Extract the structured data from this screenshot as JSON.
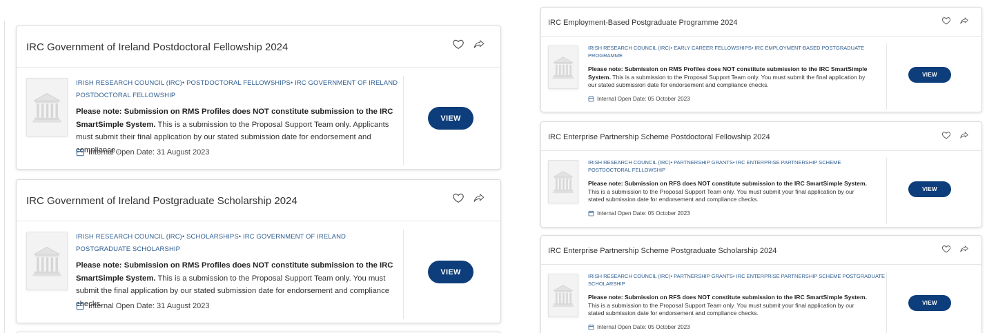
{
  "colors": {
    "accent": "#0d3d7a",
    "link": "#2e5d91",
    "border": "#dcdcdc",
    "text": "#333333",
    "background": "#ffffff"
  },
  "separator": "•",
  "icons": {
    "favourite": "heart-icon",
    "share": "share-icon",
    "thumbnail": "building-icon",
    "date": "calendar-icon"
  },
  "left_column": [
    {
      "title": "IRC Government of Ireland Postdoctoral Fellowship 2024",
      "crumbs": [
        "IRISH RESEARCH COUNCIL (IRC)",
        "POSTDOCTORAL FELLOWSHIPS",
        "IRC GOVERNMENT OF IRELAND POSTDOCTORAL FELLOWSHIP"
      ],
      "desc_bold": "Please note: Submission on RMS Profiles does NOT constitute submission to the IRC SmartSimple System.",
      "desc_text": "This is a submission to the Proposal Support Team only. Applicants must submit their final application by our stated submission date for endorsement and compliance...",
      "date": "Internal Open Date: 31 August 2023",
      "view_label": "VIEW"
    },
    {
      "title": "IRC Government of Ireland Postgraduate Scholarship 2024",
      "crumbs": [
        "IRISH RESEARCH COUNCIL (IRC)",
        "SCHOLARSHIPS",
        "IRC GOVERNMENT OF IRELAND POSTGRADUATE SCHOLARSHIP"
      ],
      "desc_bold": "Please note: Submission on RMS Profiles does NOT constitute submission to the IRC SmartSimple System.",
      "desc_text": "This is a submission to the Proposal Support Team only. You must submit the final application by our stated submission date for endorsement and compliance checks.",
      "date": "Internal Open Date: 31 August 2023",
      "view_label": "VIEW"
    }
  ],
  "right_column": [
    {
      "title": "IRC Employment-Based Postgraduate Programme 2024",
      "crumbs": [
        "IRISH RESEARCH COUNCIL (IRC)",
        "EARLY CAREER FELLOWSHIPS",
        "IRC EMPLOYMENT-BASED POSTGRADUATE PROGRAMME"
      ],
      "desc_bold": "Please note: Submission on RMS Profiles does NOT constitute submission to the IRC SmartSimple System.",
      "desc_text": "This is a submission to the Proposal Support Team only. You must submit the final application by our stated submission date for endorsement and compliance checks.",
      "date": "Internal Open Date: 05 October 2023",
      "view_label": "VIEW"
    },
    {
      "title": "IRC Enterprise Partnership Scheme Postdoctoral Fellowship 2024",
      "crumbs": [
        "IRISH RESEARCH COUNCIL (IRC)",
        "PARTNERSHIP GRANTS",
        "IRC ENTERPRISE PARTNERSHIP SCHEME POSTDOCTORAL FELLOWSHIP"
      ],
      "desc_bold": "Please note: Submission on RFS does NOT constitute submission to the IRC SmartSimple System.",
      "desc_text": "This is a submission to the Proposal Support Team only. You must submit your final application by our stated submission date for endorsement and compliance checks.",
      "date": "Internal Open Date: 05 October 2023",
      "view_label": "VIEW"
    },
    {
      "title": "IRC Enterprise Partnership Scheme Postgraduate Scholarship 2024",
      "crumbs": [
        "IRISH RESEARCH COUNCIL (IRC)",
        "PARTNERSHIP GRANTS",
        "IRC ENTERPRISE PARTNERSHIP SCHEME POSTGRADUATE SCHOLARSHIP"
      ],
      "desc_bold": "Please note: Submission on RFS does NOT constitute submission to the IRC SmartSimple System.",
      "desc_text": "This is a submission to the Proposal Support Team only. You must submit your final application by our stated submission date for endorsement and compliance checks.",
      "date": "Internal Open Date: 05 October 2023",
      "view_label": "VIEW"
    }
  ]
}
